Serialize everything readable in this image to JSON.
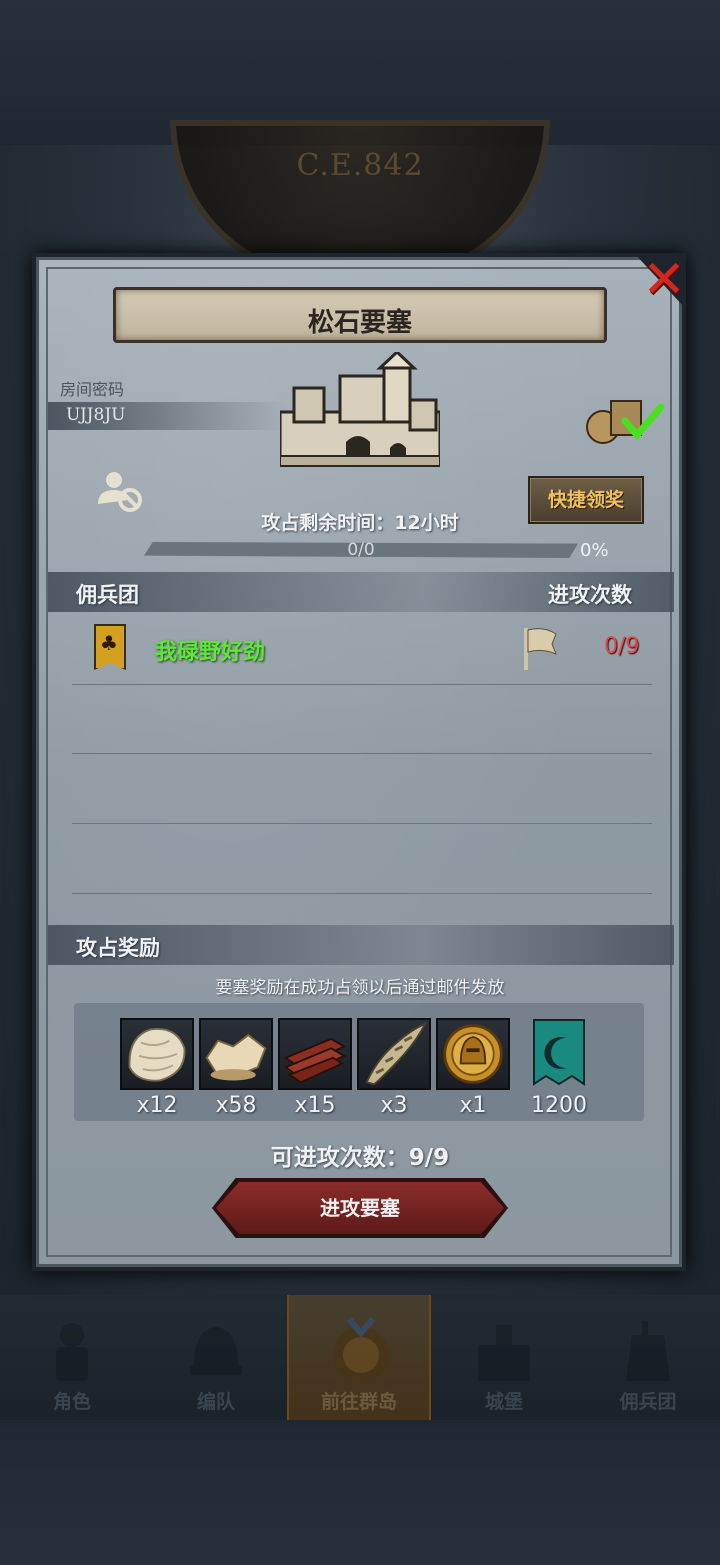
{
  "background": {
    "era_label": "C.E.842"
  },
  "fortress": {
    "title": "松石要塞",
    "room_code_label": "房间密码",
    "room_code": "UJJ8JU",
    "quick_claim_label": "快捷领奖",
    "remaining_time_text": "攻占剩余时间：12小时",
    "progress_text": "0/0",
    "progress_percent_text": "0%",
    "progress_fraction": 0
  },
  "mercenary_section": {
    "title": "佣兵团",
    "attack_count_header": "进攻次数",
    "rows": [
      {
        "guild_name": "我碌野好劲",
        "attack_count": "0/9"
      }
    ]
  },
  "reward_section": {
    "title": "攻占奖励",
    "note": "要塞奖励在成功占领以后通过邮件发放",
    "items": [
      {
        "icon": "pelt-icon",
        "qty": "x12"
      },
      {
        "icon": "fur-icon",
        "qty": "x58"
      },
      {
        "icon": "wood-planks-icon",
        "qty": "x15"
      },
      {
        "icon": "horn-icon",
        "qty": "x3"
      },
      {
        "icon": "gold-helmet-coin-icon",
        "qty": "x1"
      },
      {
        "icon": "guild-banner-moon-icon",
        "qty": "1200"
      }
    ]
  },
  "attempts_text": "可进攻次数：9/9",
  "attack_button_label": "进攻要塞",
  "tabs": [
    {
      "label": "角色",
      "icon": "knight-icon"
    },
    {
      "label": "编队",
      "icon": "helmet-icon"
    },
    {
      "label": "前往群岛",
      "icon": "compass-icon"
    },
    {
      "label": "城堡",
      "icon": "castle-icon"
    },
    {
      "label": "佣兵团",
      "icon": "mercenary-icon"
    }
  ],
  "colors": {
    "guild_name": "#5ce838",
    "attack_count": "#e04848",
    "quick_claim_text": "#f0c060",
    "close_x": "#d4261e",
    "attack_button": "#8a2c2a"
  }
}
